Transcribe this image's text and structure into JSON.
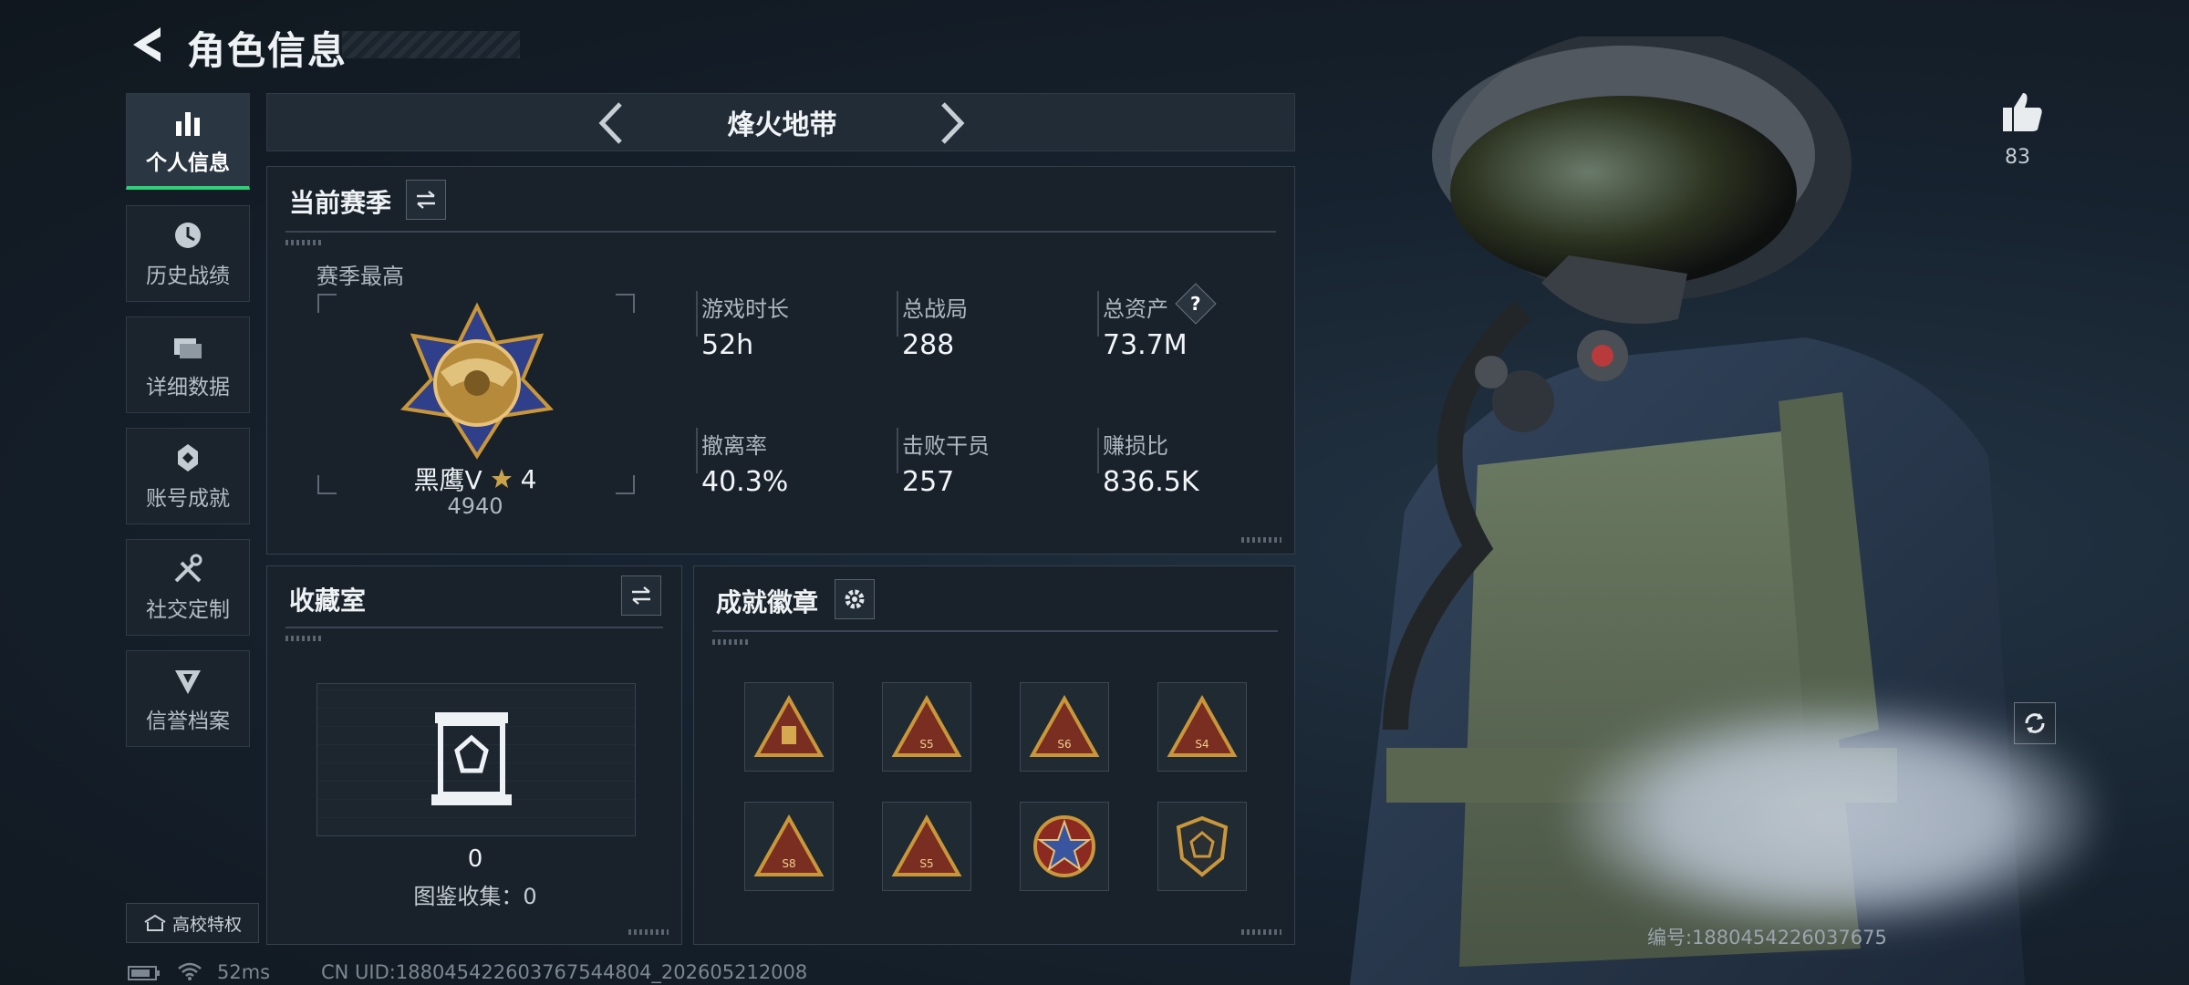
{
  "header": {
    "title": "角色信息"
  },
  "nav": [
    {
      "label": "个人信息",
      "icon": "bar-chart-icon",
      "active": true
    },
    {
      "label": "历史战绩",
      "icon": "clock-icon",
      "active": false
    },
    {
      "label": "详细数据",
      "icon": "folders-icon",
      "active": false
    },
    {
      "label": "账号成就",
      "icon": "achievement-icon",
      "active": false
    },
    {
      "label": "社交定制",
      "icon": "tools-icon",
      "active": false
    },
    {
      "label": "信誉档案",
      "icon": "credit-icon",
      "active": false
    }
  ],
  "school": {
    "label": "高校特权"
  },
  "mode": {
    "name": "烽火地带"
  },
  "season": {
    "title": "当前赛季",
    "best_label": "赛季最高",
    "rank_name": "黑鹰Ⅴ",
    "rank_stars": "4",
    "rank_score": "4940",
    "stats": [
      {
        "label": "游戏时长",
        "value": "52h"
      },
      {
        "label": "总战局",
        "value": "288"
      },
      {
        "label": "总资产",
        "value": "73.7M",
        "help": "?"
      },
      {
        "label": "撤离率",
        "value": "40.3%"
      },
      {
        "label": "击败干员",
        "value": "257"
      },
      {
        "label": "赚损比",
        "value": "836.5K"
      }
    ]
  },
  "collection": {
    "title": "收藏室",
    "count": "0",
    "catalog": "图鉴收集：0"
  },
  "achievements": {
    "title": "成就徽章",
    "badges": [
      {
        "icon": "triangle-badge-icon",
        "code": ""
      },
      {
        "icon": "triangle-badge-icon",
        "code": "S5"
      },
      {
        "icon": "triangle-badge-icon",
        "code": "S6"
      },
      {
        "icon": "triangle-badge-icon",
        "code": "S4"
      },
      {
        "icon": "triangle-badge-icon",
        "code": "S8"
      },
      {
        "icon": "triangle-badge-icon",
        "code": "S5"
      },
      {
        "icon": "round-medal-icon",
        "code": ""
      },
      {
        "icon": "shield-badge-icon",
        "code": ""
      }
    ]
  },
  "likes": {
    "count": "83"
  },
  "footer": {
    "ping": "52ms",
    "uid": "CN UID:18804542260376754480​4_202605212008",
    "serial": "编号:1880454226037675"
  },
  "colors": {
    "accent": "#2fd07a",
    "panel": "#19222b",
    "gold": "#c9973a"
  }
}
